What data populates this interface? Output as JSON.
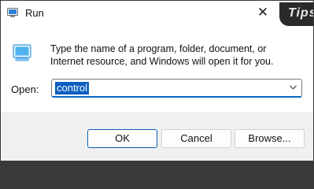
{
  "window": {
    "title": "Run",
    "close_glyph": "✕"
  },
  "watermark": "Tips",
  "icons": {
    "app": "run-app-icon",
    "dialog": "run-dialog-icon",
    "close": "close-icon",
    "dropdown": "chevron-down-icon"
  },
  "prompt": {
    "description": "Type the name of a program, folder, document, or Internet resource, and Windows will open it for you."
  },
  "open_field": {
    "label": "Open:",
    "value": "control"
  },
  "buttons": {
    "ok": "OK",
    "cancel": "Cancel",
    "browse": "Browse..."
  },
  "colors": {
    "accent": "#0b67c2",
    "selection": "#0a5fbf",
    "footer": "#f0f0f0"
  }
}
